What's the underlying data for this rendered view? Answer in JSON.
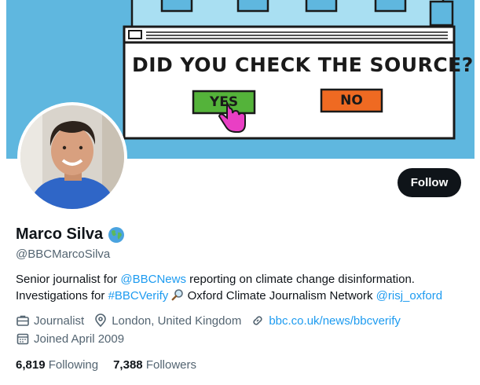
{
  "banner": {
    "question": "DID YOU CHECK THE SOURCE?",
    "yes_label": "YES",
    "no_label": "NO"
  },
  "profile": {
    "name": "Marco Silva",
    "handle": "@BBCMarcoSilva",
    "follow_label": "Follow"
  },
  "bio": {
    "part1": "Senior journalist for ",
    "mention1": "@BBCNews",
    "part2": " reporting on climate change disinformation.",
    "part3": "Investigations for ",
    "hashtag": "#BBCVerify",
    "part4": " Oxford Climate Journalism Network ",
    "mention2": "@risj_oxford"
  },
  "meta": {
    "job": "Journalist",
    "location": "London, United Kingdom",
    "website": "bbc.co.uk/news/bbcverify",
    "joined": "Joined April 2009"
  },
  "stats": {
    "following_count": "6,819",
    "following_label": "Following",
    "followers_count": "7,388",
    "followers_label": "Followers"
  },
  "colors": {
    "banner_bg": "#5fb7df",
    "yes_button": "#54b33a",
    "no_button": "#ef6a22",
    "link": "#1d9bf0",
    "pointer_hand": "#e93fc4"
  }
}
